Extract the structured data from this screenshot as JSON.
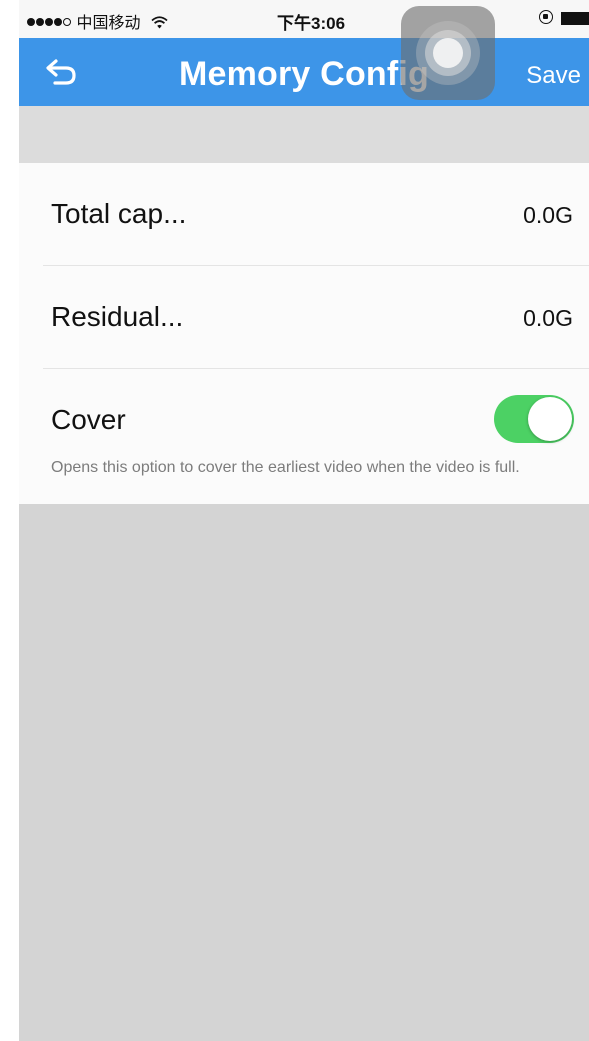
{
  "status_bar": {
    "carrier": "中国移动",
    "time": "下午3:06",
    "signal_bars_filled": 4,
    "signal_bars_total": 5
  },
  "nav": {
    "title": "Memory Config",
    "save_label": "Save"
  },
  "rows": [
    {
      "label": "Total cap...",
      "value": "0.0G"
    },
    {
      "label": "Residual...",
      "value": "0.0G"
    },
    {
      "label": "Cover"
    }
  ],
  "cover": {
    "enabled": true,
    "description": "Opens this option to cover the earliest video when the video is full."
  },
  "colors": {
    "nav_background": "#3d95e8",
    "toggle_on": "#4cd164",
    "page_background": "#d4d4d4"
  },
  "icons": [
    "back-arrow-icon",
    "wifi-icon",
    "orientation-lock-icon",
    "battery-icon",
    "assistive-touch-icon"
  ]
}
